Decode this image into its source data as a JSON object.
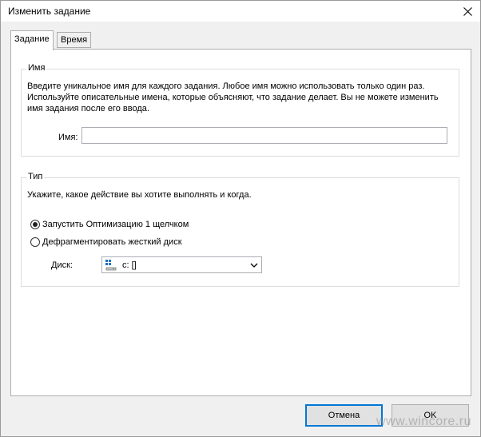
{
  "window": {
    "title": "Изменить задание"
  },
  "tabs": [
    {
      "label": "Задание",
      "active": true
    },
    {
      "label": "Время",
      "active": false
    }
  ],
  "name_group": {
    "legend": "Имя",
    "description_lines": [
      "Введите уникальное имя для каждого задания. Любое имя можно использовать только один раз.",
      "Используйте описательные имена, которые объясняют, что задание делает. Вы не можете изменить",
      "имя задания после его ввода."
    ],
    "field_label": "Имя:",
    "field_value": "",
    "field_placeholder": ""
  },
  "type_group": {
    "legend": "Тип",
    "description": "Укажите, какое действие вы хотите выполнять и когда.",
    "options": [
      {
        "label": "Запустить Оптимизацию 1 щелчком",
        "selected": true
      },
      {
        "label": "Дефрагментировать жесткий диск",
        "selected": false
      }
    ],
    "disk_label": "Диск:",
    "disk_value": "c: []"
  },
  "buttons": {
    "cancel": "Отмена",
    "ok": "OK"
  },
  "watermark": "www.wincore.ru",
  "icons": {
    "close": "close-icon",
    "drive": "drive-icon",
    "dropdown": "chevron-down-icon"
  },
  "colors": {
    "accent": "#0078d7",
    "panel": "#ffffff",
    "window_bg": "#f0f0f0"
  }
}
